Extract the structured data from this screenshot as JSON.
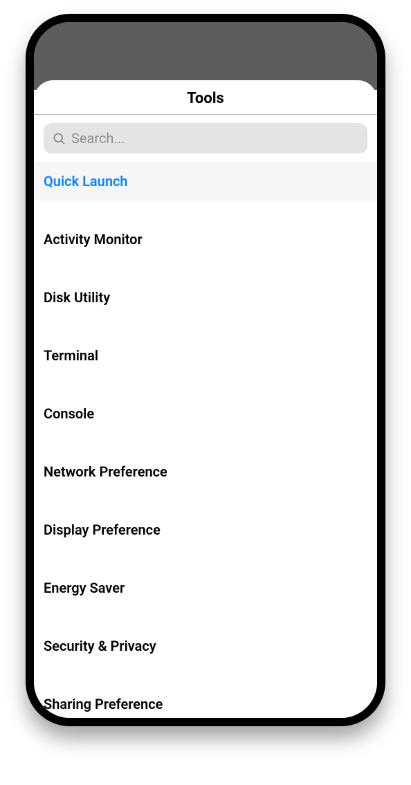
{
  "header": {
    "title": "Tools"
  },
  "search": {
    "placeholder": "Search...",
    "value": ""
  },
  "list": {
    "items": [
      {
        "label": "Quick Launch",
        "selected": true
      },
      {
        "label": "Activity Monitor",
        "selected": false
      },
      {
        "label": "Disk Utility",
        "selected": false
      },
      {
        "label": "Terminal",
        "selected": false
      },
      {
        "label": "Console",
        "selected": false
      },
      {
        "label": "Network Preference",
        "selected": false
      },
      {
        "label": "Display Preference",
        "selected": false
      },
      {
        "label": "Energy Saver",
        "selected": false
      },
      {
        "label": "Security & Privacy",
        "selected": false
      },
      {
        "label": "Sharing Preference",
        "selected": false
      }
    ]
  },
  "colors": {
    "accent": "#0a84ff",
    "search_bg": "#e4e4e6",
    "status_bar": "#5d5d5d"
  }
}
